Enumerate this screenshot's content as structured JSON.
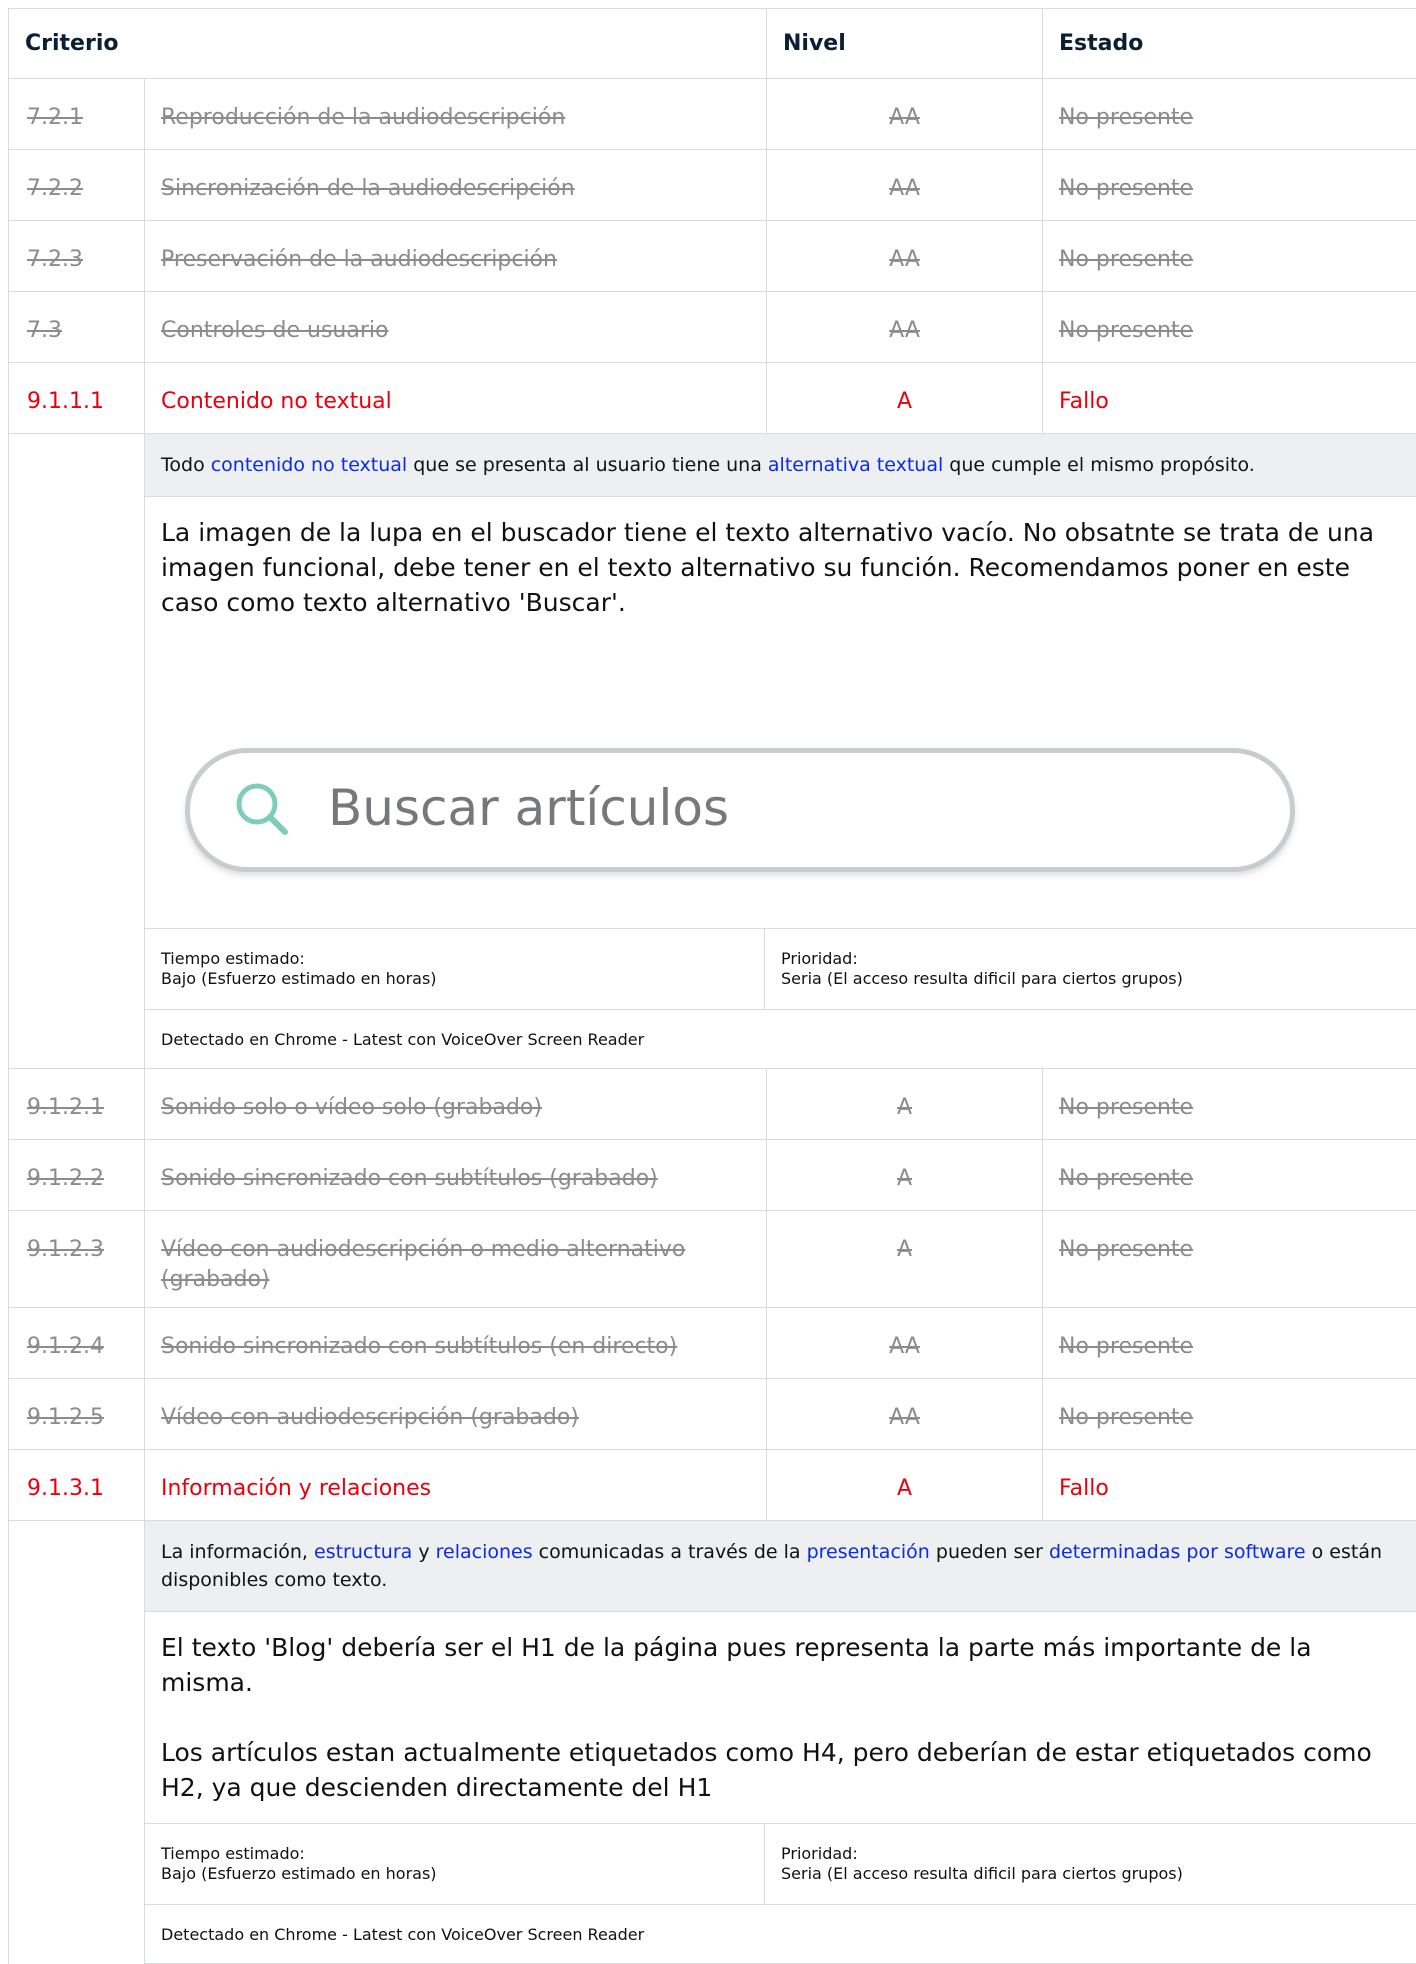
{
  "header": {
    "col1": "Criterio",
    "col3": "Nivel",
    "col4": "Estado"
  },
  "rows_a": [
    {
      "id": "7.2.1",
      "criterion": "Reproducción de la audiodescripción",
      "level": "AA",
      "status": "No presente"
    },
    {
      "id": "7.2.2",
      "criterion": "Sincronización de la audiodescripción",
      "level": "AA",
      "status": "No presente"
    },
    {
      "id": "7.2.3",
      "criterion": "Preservación de la audiodescripción",
      "level": "AA",
      "status": "No presente"
    },
    {
      "id": "7.3",
      "criterion": "Controles de usuario",
      "level": "AA",
      "status": "No presente"
    }
  ],
  "fail1": {
    "id": "9.1.1.1",
    "criterion": "Contenido no textual",
    "level": "A",
    "status": "Fallo",
    "desc_1": "Todo ",
    "desc_link1": "contenido no textual",
    "desc_2": " que se presenta al usuario tiene una ",
    "desc_link2": "alternativa textual",
    "desc_3": " que cumple el mismo propósito.",
    "note": "La imagen de la lupa en el buscador tiene el texto alternativo vacío. No obsatnte se trata de una imagen funcional, debe tener en el texto alternativo su función. Recomendamos poner en este caso como texto alternativo 'Buscar'.",
    "search_placeholder": "Buscar artículos",
    "time_label": "Tiempo estimado:",
    "time_value": "Bajo (Esfuerzo estimado en horas)",
    "priority_label": "Prioridad:",
    "priority_value": "Seria (El acceso resulta dificil para ciertos grupos)",
    "detected": "Detectado en Chrome - Latest con VoiceOver Screen Reader"
  },
  "rows_b": [
    {
      "id": "9.1.2.1",
      "criterion": "Sonido solo o vídeo solo (grabado)",
      "level": "A",
      "status": "No presente"
    },
    {
      "id": "9.1.2.2",
      "criterion": "Sonido sincronizado con subtítulos (grabado)",
      "level": "A",
      "status": "No presente"
    },
    {
      "id": "9.1.2.3",
      "criterion": "Vídeo con audiodescripción o medio alternativo (grabado)",
      "level": "A",
      "status": "No presente"
    },
    {
      "id": "9.1.2.4",
      "criterion": "Sonido sincronizado con subtítulos (en directo)",
      "level": "AA",
      "status": "No presente"
    },
    {
      "id": "9.1.2.5",
      "criterion": "Vídeo con audiodescripción (grabado)",
      "level": "AA",
      "status": "No presente"
    }
  ],
  "fail2": {
    "id": "9.1.3.1",
    "criterion": "Información y relaciones",
    "level": "A",
    "status": "Fallo",
    "desc_1": "La información, ",
    "desc_link1": "estructura",
    "desc_2": " y ",
    "desc_link2": "relaciones",
    "desc_3": " comunicadas a través de la ",
    "desc_link3": "presentación",
    "desc_4": " pueden ser ",
    "desc_link4": "determinadas por software",
    "desc_5": " o están disponibles como texto.",
    "note_p1": "El texto 'Blog' debería ser el H1 de la página pues representa la parte más importante de la misma.",
    "note_p2": "Los artículos estan actualmente etiquetados como H4, pero deberían de estar etiquetados como H2, ya que descienden directamente del H1",
    "time_label": "Tiempo estimado:",
    "time_value": "Bajo (Esfuerzo estimado en horas)",
    "priority_label": "Prioridad:",
    "priority_value": "Seria (El acceso resulta dificil para ciertos grupos)",
    "detected": "Detectado en Chrome - Latest con VoiceOver Screen Reader"
  },
  "colors": {
    "fail": "#e8000d",
    "link": "#0a2be8",
    "na": "#8c8c8c",
    "desc_bg": "#eeeff1",
    "magnifier": "#7ecdb9"
  },
  "icons": {
    "search": "magnifier-icon"
  }
}
